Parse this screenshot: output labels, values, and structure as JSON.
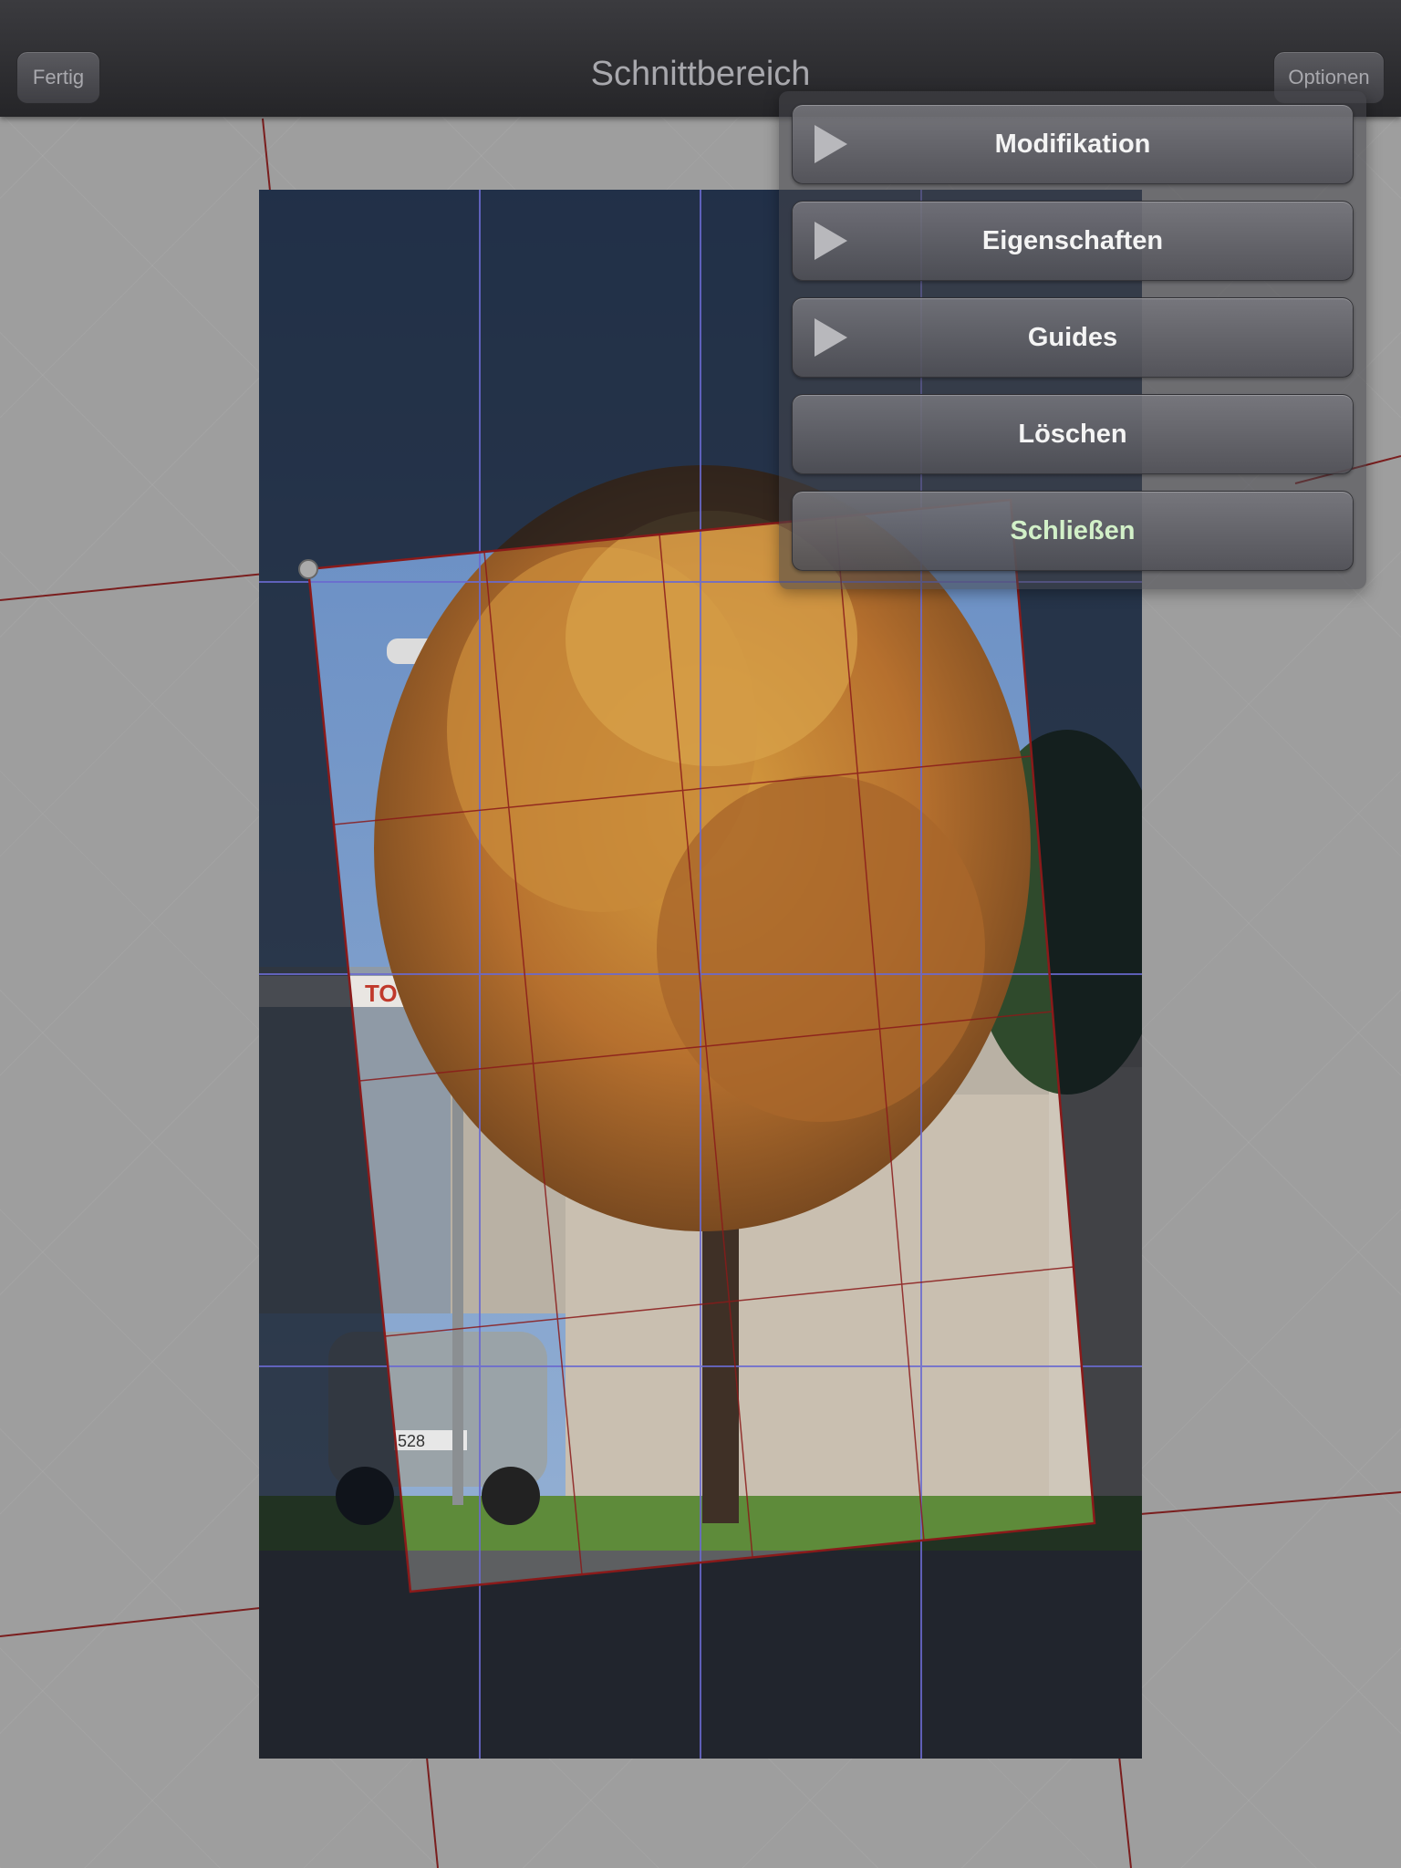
{
  "toolbar": {
    "title": "Schnittbereich",
    "done_label": "Fertig",
    "options_label": "Optionen"
  },
  "menu": {
    "items": [
      {
        "label": "Modifikation",
        "expandable": true
      },
      {
        "label": "Eigenschaften",
        "expandable": true
      },
      {
        "label": "Guides",
        "expandable": true
      },
      {
        "label": "Löschen",
        "expandable": false
      },
      {
        "label": "Schließen",
        "expandable": false
      }
    ]
  },
  "canvas": {
    "photo_sign_text": "TOY",
    "plate_text": "528",
    "colors": {
      "crop_outline": "#8a1a1a",
      "guides": "#6a6ad0",
      "close_label": "#d2f0c8"
    }
  }
}
